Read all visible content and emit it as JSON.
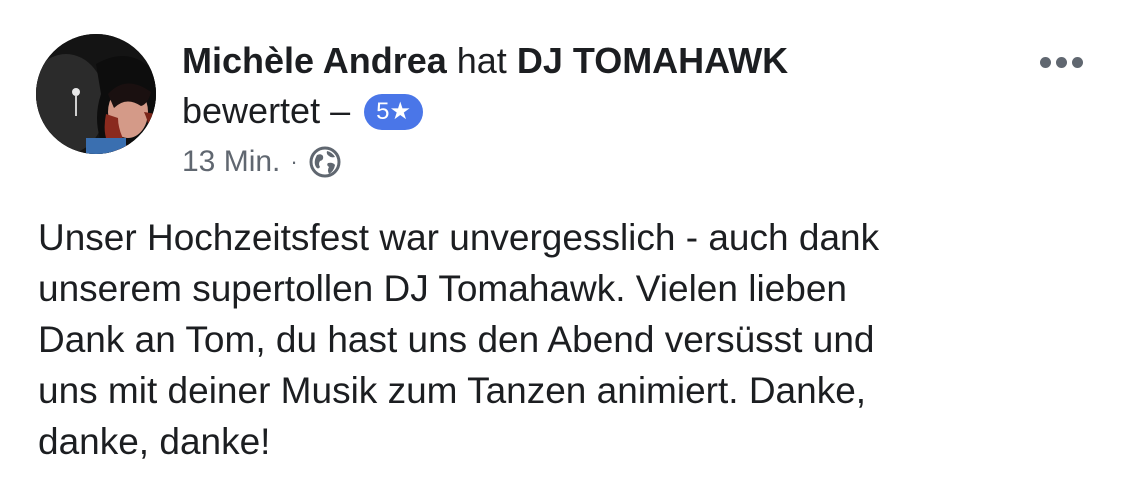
{
  "post": {
    "author": "Michèle Andrea",
    "connector": "hat",
    "page_name": "DJ TOMAHAWK",
    "action": "bewertet –",
    "rating": "5★",
    "time": "13 Min.",
    "separator": "·",
    "privacy_icon": "globe-icon",
    "menu_icon": "more-options-icon",
    "body_lines": [
      "Unser Hochzeitsfest war unvergesslich - auch dank",
      "unserem supertollen DJ Tomahawk. Vielen lieben",
      "Dank an Tom, du hast uns den Abend versüsst und",
      "uns mit deiner Musik zum Tanzen animiert. Danke,",
      "danke, danke!"
    ]
  },
  "colors": {
    "badge": "#4a76e8",
    "meta_text": "#606770",
    "text": "#1c1e21"
  }
}
